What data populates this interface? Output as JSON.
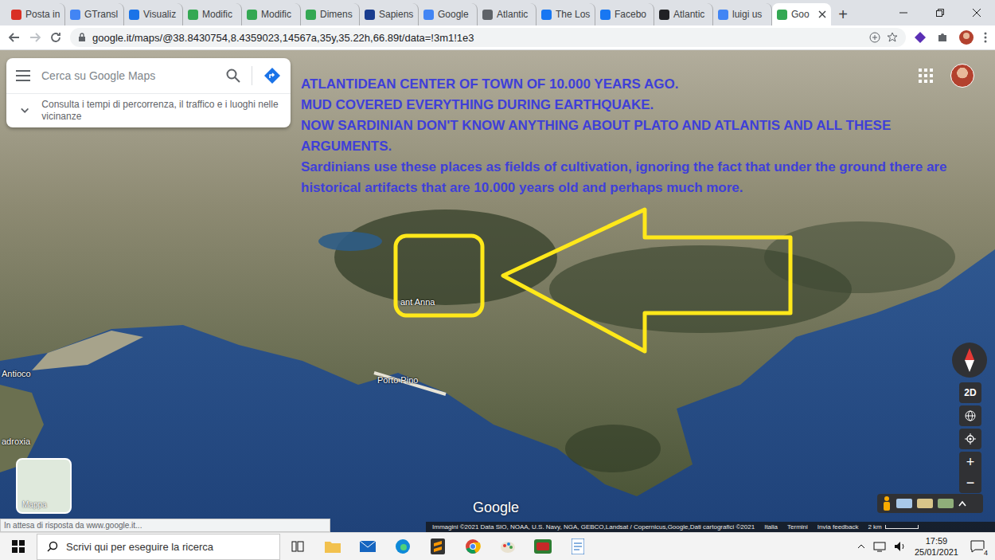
{
  "browser": {
    "tabs": [
      {
        "label": "Posta in",
        "selected": false,
        "color": "#d93025"
      },
      {
        "label": "GTransl",
        "selected": false,
        "color": "#4285f4"
      },
      {
        "label": "Visualiz",
        "selected": false,
        "color": "#1a73e8"
      },
      {
        "label": "Modific",
        "selected": false,
        "color": "#34a853"
      },
      {
        "label": "Modific",
        "selected": false,
        "color": "#34a853"
      },
      {
        "label": "Dimens",
        "selected": false,
        "color": "#34a853"
      },
      {
        "label": "Sapiens",
        "selected": false,
        "color": "#1a3d8f"
      },
      {
        "label": "Google",
        "selected": false,
        "color": "#4285f4"
      },
      {
        "label": "Atlantic",
        "selected": false,
        "color": "#5f6368"
      },
      {
        "label": "The Los",
        "selected": false,
        "color": "#1877f2"
      },
      {
        "label": "Facebo",
        "selected": false,
        "color": "#1877f2"
      },
      {
        "label": "Atlantic",
        "selected": false,
        "color": "#202124"
      },
      {
        "label": "luigi us",
        "selected": false,
        "color": "#4285f4"
      },
      {
        "label": "Goo",
        "selected": true,
        "color": "#34a853"
      }
    ],
    "new_tab": "+",
    "url": "google.it/maps/@38.8430754,8.4359023,14567a,35y,35.22h,66.89t/data=!3m1!1e3"
  },
  "map": {
    "search": {
      "placeholder": "Cerca su Google Maps"
    },
    "hint": "Consulta i tempi di percorrenza, il traffico e i luoghi nelle vicinanze",
    "annotation": [
      "ATLANTIDEAN CENTER OF TOWN OF 10.000 YEARS AGO.",
      "MUD COVERED EVERYTHING DURING EARTHQUAKE.",
      "NOW SARDINIAN DON'T KNOW ANYTHING ABOUT PLATO AND ATLANTIS AND ALL THESE ARGUMENTS.",
      "Sardinians use these places as fields of cultivation, ignoring the fact that under the ground there are historical artifacts that are 10.000 years old and perhaps much more."
    ],
    "labels": [
      {
        "text": "Antioco",
        "place": "antioco"
      },
      {
        "text": "Porto Pino",
        "place": "porto-pino"
      },
      {
        "text": "adroxia",
        "place": "adroxia"
      },
      {
        "text": "ant Anna",
        "place": "sant-anna"
      }
    ],
    "controls": {
      "view": "2D",
      "zoom_in": "+",
      "zoom_out": "−"
    },
    "layer_button": "Mappa",
    "logo": "Google",
    "footer": {
      "credits": "Immagini ©2021 Data SIO, NOAA, U.S. Navy, NGA, GEBCO,Landsat / Copernicus,Google,Dati cartografici ©2021",
      "links": [
        "Italia",
        "Termini",
        "Invia feedback"
      ],
      "scale": "2 km"
    },
    "status": "In attesa di risposta da www.google.it..."
  },
  "taskbar": {
    "search_placeholder": "Scrivi qui per eseguire la ricerca",
    "time": "17:59",
    "date": "25/01/2021",
    "notifications": "4"
  }
}
